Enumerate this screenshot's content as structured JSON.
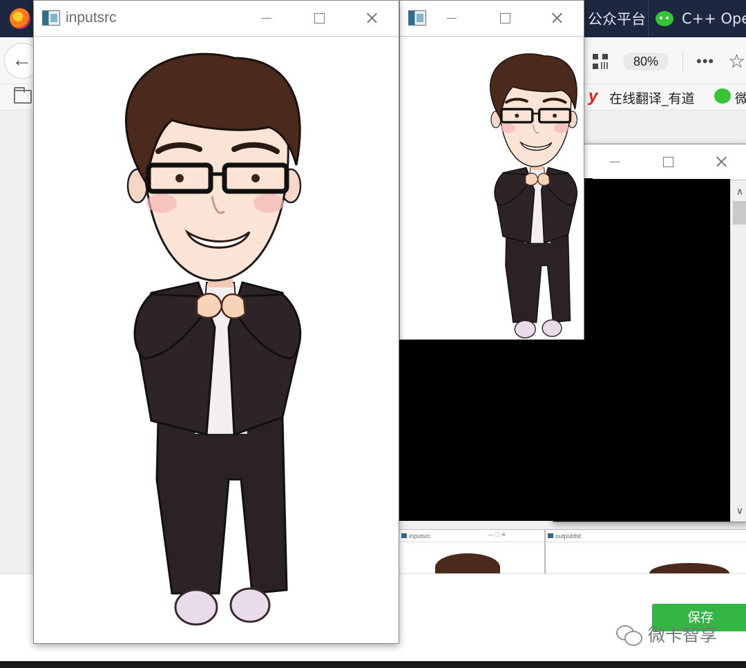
{
  "browser": {
    "tabs": [
      {
        "label": "公众平台"
      },
      {
        "label": "C++ Ope"
      }
    ],
    "back_icon": "←",
    "zoom": "80%",
    "more_icon": "•••",
    "star_icon": "☆",
    "bookmarks": [
      {
        "icon": "y",
        "label": "在线翻译_有道"
      },
      {
        "label": "微"
      }
    ],
    "save_label": "保存"
  },
  "watermark": "微卡智享",
  "windows": {
    "inputsrc": {
      "title": "inputsrc"
    },
    "output": {
      "title": ""
    },
    "third": {
      "title": "",
      "scroll_up": "∧",
      "scroll_down": "∨"
    }
  },
  "thumbnails": [
    {
      "title": "inputsrc",
      "ctl": "—   □   ✕"
    },
    {
      "title": "outputdst",
      "ctl": ""
    }
  ],
  "colors": {
    "tabbar": "#1d2740",
    "save_button": "#34b546",
    "hair": "#4a2a1c",
    "suit": "#2c2426",
    "skin": "#fbe3d6",
    "shoes": "#e8dbe6"
  }
}
